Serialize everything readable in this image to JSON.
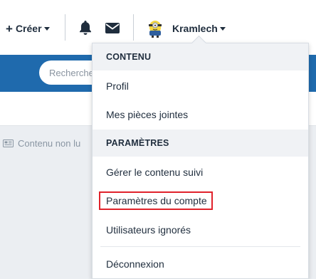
{
  "header": {
    "create_label": "Créer",
    "create_icon": "plus-icon",
    "notifications_icon": "bell-icon",
    "messages_icon": "envelope-icon",
    "username": "Kramlech",
    "avatar_icon": "minion-avatar"
  },
  "nav": {
    "search_placeholder": "Recherche"
  },
  "subbar": {
    "unread_label": "Contenu non lu",
    "unread_icon": "newspaper-icon"
  },
  "menu": {
    "section_content": "CONTENU",
    "profile": "Profil",
    "attachments": "Mes pièces jointes",
    "section_settings": "PARAMÈTRES",
    "followed": "Gérer le contenu suivi",
    "account_settings": "Paramètres du compte",
    "ignored_users": "Utilisateurs ignorés",
    "logout": "Déconnexion"
  },
  "colors": {
    "nav_blue": "#1f6aad",
    "highlight_red": "#e0222b",
    "text_dark": "#1f2d3d",
    "section_bg": "#f0f2f5"
  }
}
